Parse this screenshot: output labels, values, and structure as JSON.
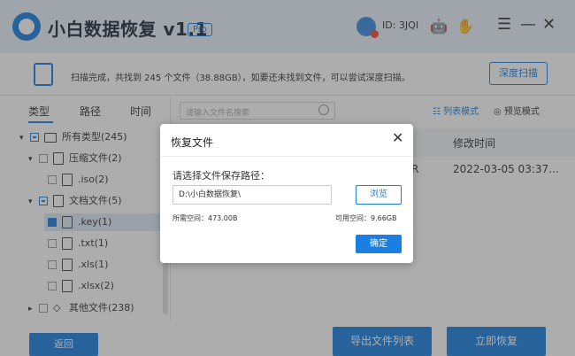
{
  "app": {
    "title": "小白数据恢复 v1.1",
    "badge": "Pro",
    "user_id": "ID: 3JQI"
  },
  "window_controls": {
    "menu": "☰",
    "minimize": "—",
    "close": "✕"
  },
  "scan": {
    "message": "扫描完成，共找到 245 个文件（38.88GB），如要还未找到文件，可以尝试深度扫描。",
    "deep_scan_label": "深度扫描"
  },
  "tabs": [
    "类型",
    "路径",
    "时间"
  ],
  "search": {
    "placeholder": "请输入文件名搜索"
  },
  "view_modes": {
    "list": "列表模式",
    "preview": "预览模式"
  },
  "table": {
    "time_header": "修改时间",
    "row_partial": "R",
    "row_time": "2022-03-05 03:37..."
  },
  "tree": {
    "all_types": "所有类型(245)",
    "archive": "压缩文件(2)",
    "iso": ".iso(2)",
    "documents": "文档文件(5)",
    "key": ".key(1)",
    "txt": ".txt(1)",
    "xls": ".xls(1)",
    "xlsx": ".xlsx(2)",
    "other": "其他文件(238)"
  },
  "buttons": {
    "back": "返回",
    "export": "导出文件列表",
    "recover": "立即恢复"
  },
  "dialog": {
    "title": "恢复文件",
    "prompt": "请选择文件保存路径：",
    "path": "D:\\小白数据恢复\\",
    "browse": "浏览",
    "needed": "所需空间：473.00B",
    "available": "可用空间：9.66GB",
    "ok": "确定"
  },
  "colors": {
    "accent": "#1a7fe0"
  }
}
